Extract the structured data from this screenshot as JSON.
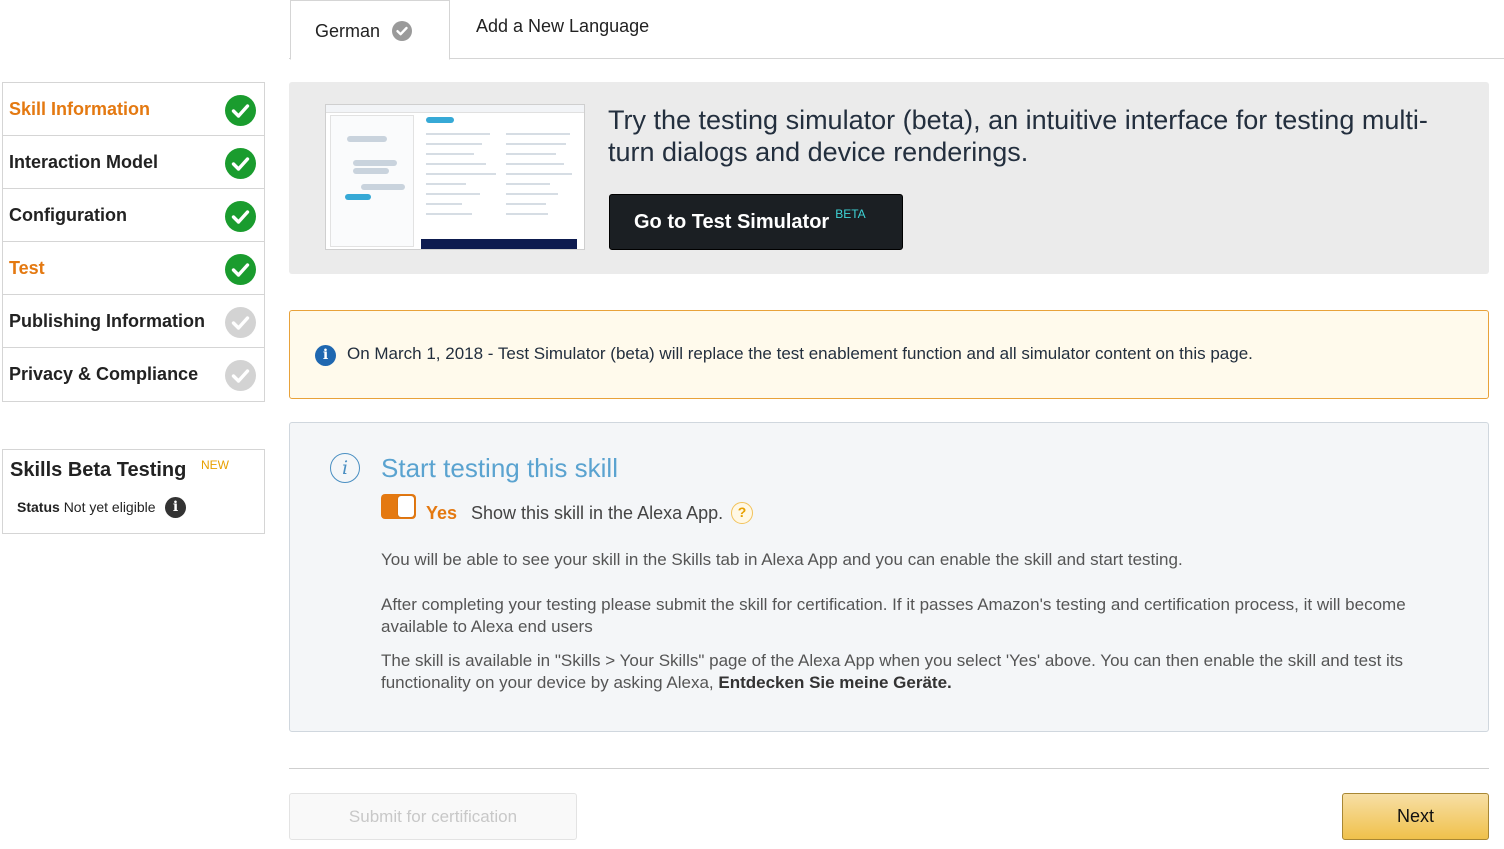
{
  "tabs": {
    "active": "German",
    "add_language": "Add a New Language"
  },
  "sidebar": {
    "items": [
      {
        "label": "Skill Information",
        "status": "complete",
        "highlight": true
      },
      {
        "label": "Interaction Model",
        "status": "complete",
        "highlight": false
      },
      {
        "label": "Configuration",
        "status": "complete",
        "highlight": false
      },
      {
        "label": "Test",
        "status": "complete",
        "highlight": true
      },
      {
        "label": "Publishing Information",
        "status": "incomplete",
        "highlight": false
      },
      {
        "label": "Privacy & Compliance",
        "status": "incomplete",
        "highlight": false
      }
    ]
  },
  "beta": {
    "title": "Skills Beta Testing",
    "new_badge": "NEW",
    "status_label": "Status",
    "status_value": "Not yet eligible"
  },
  "promo": {
    "text": "Try the testing simulator (beta), an intuitive interface for testing multi-turn dialogs and device renderings.",
    "button_label": "Go to Test Simulator",
    "button_sup": "BETA"
  },
  "notice": {
    "text": "On March 1, 2018 - Test Simulator (beta) will replace the test enablement function and all simulator content on this page."
  },
  "panel": {
    "title": "Start testing this skill",
    "toggle_value": "Yes",
    "toggle_desc": "Show this skill in the Alexa App.",
    "p1": "You will be able to see your skill in the Skills tab in Alexa App and you can enable the skill and start testing.",
    "p2": "After completing your testing please submit the skill for certification. If it passes Amazon's testing and certification process, it will become available to Alexa end users",
    "p3": "The skill is available in \"Skills > Your Skills\" page of the Alexa App when you select 'Yes' above. You can then enable the skill and test its functionality on your device by asking Alexa, ",
    "p3_bold": "Entdecken Sie meine Geräte."
  },
  "footer": {
    "submit_label": "Submit for certification",
    "next_label": "Next"
  },
  "colors": {
    "accent_orange": "#e47911",
    "check_green": "#1a9c2e",
    "title_blue": "#5aa3d0"
  }
}
